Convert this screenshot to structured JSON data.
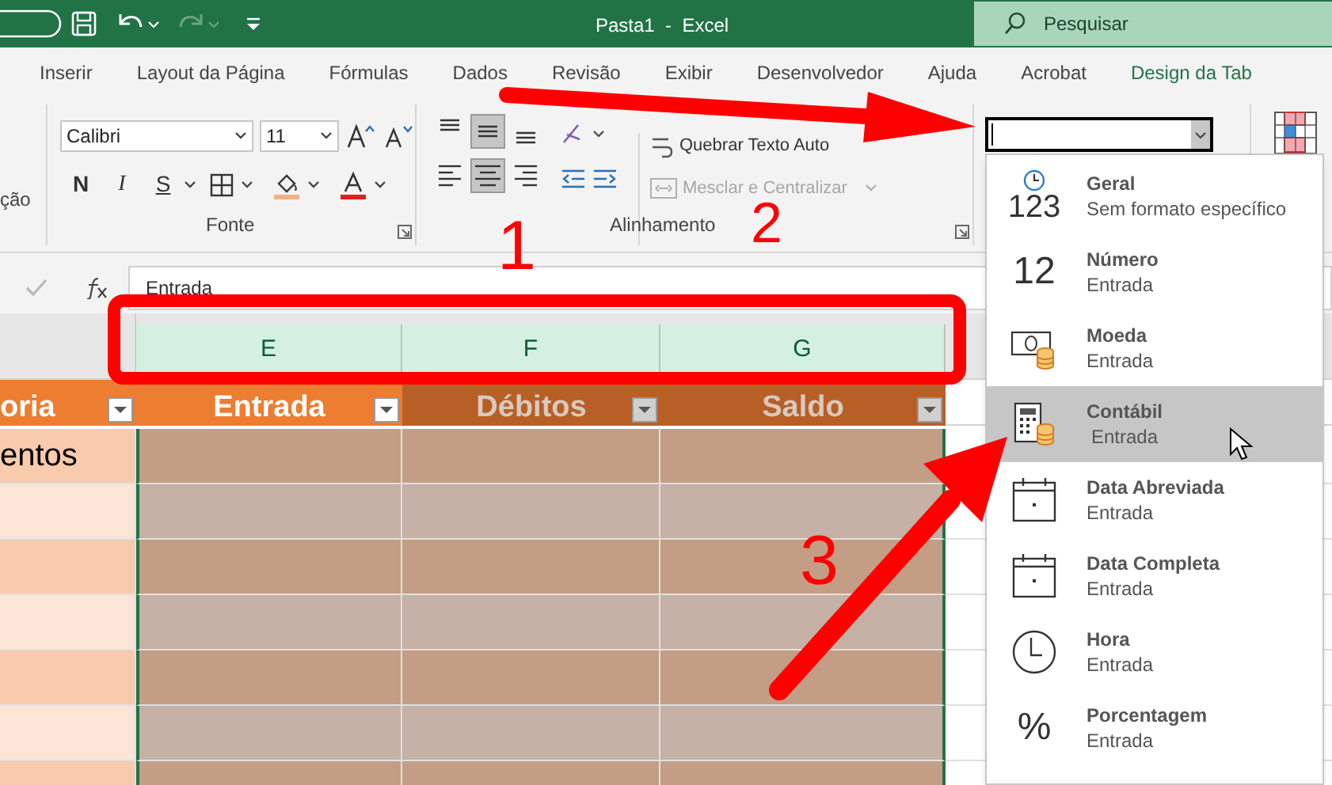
{
  "title_bar": {
    "title": "Pasta1  -  Excel",
    "search": {
      "placeholder": "Pesquisar"
    }
  },
  "ribbon_tabs": [
    {
      "label": "Inserir",
      "kind": "standard",
      "selected": false
    },
    {
      "label": "Layout da Página",
      "kind": "standard",
      "selected": false
    },
    {
      "label": "Fórmulas",
      "kind": "standard",
      "selected": false
    },
    {
      "label": "Dados",
      "kind": "standard",
      "selected": false
    },
    {
      "label": "Revisão",
      "kind": "standard",
      "selected": false
    },
    {
      "label": "Exibir",
      "kind": "standard",
      "selected": false
    },
    {
      "label": "Desenvolvedor",
      "kind": "standard",
      "selected": false
    },
    {
      "label": "Ajuda",
      "kind": "standard",
      "selected": false
    },
    {
      "label": "Acrobat",
      "kind": "standard",
      "selected": false
    },
    {
      "label": "Design da Tab",
      "kind": "contextual",
      "selected": false
    }
  ],
  "ribbon": {
    "cut_group_label": "ção",
    "font": {
      "name": "Calibri",
      "size": "11"
    },
    "style_buttons": [
      {
        "label": "N",
        "kind": "bold"
      },
      {
        "label": "I",
        "kind": "italic"
      },
      {
        "label": "S",
        "kind": "underline"
      }
    ],
    "font_group_label": "Fonte",
    "vertical_align": [
      {
        "selected": false
      },
      {
        "selected": true
      },
      {
        "selected": false
      }
    ],
    "horizontal_align": [
      {
        "selected": false
      },
      {
        "selected": true
      },
      {
        "selected": false
      }
    ],
    "wrap_text": {
      "label": "Quebrar Texto Auto",
      "disabled": false
    },
    "merge": {
      "label": "Mesclar e Centralizar",
      "disabled": true
    },
    "alignment_group_label": "Alinhamento"
  },
  "formula_bar": {
    "value": "Entrada"
  },
  "sheet": {
    "column_headers": [
      {
        "label": "E",
        "selected": true
      },
      {
        "label": "F",
        "selected": true
      },
      {
        "label": "G",
        "selected": true
      }
    ],
    "table_headers": [
      {
        "label": "oria",
        "kind": "plain"
      },
      {
        "label": "Entrada",
        "kind": "plain"
      },
      {
        "label": "Débitos",
        "kind": "shaded"
      },
      {
        "label": "Saldo",
        "kind": "shaded"
      }
    ],
    "rows": [
      {
        "label": "entos"
      }
    ]
  },
  "format_menu": {
    "items": [
      {
        "kind": "clock",
        "icon_text": "123",
        "title": "Geral",
        "subtitle": "Sem formato específico",
        "selected": false
      },
      {
        "kind": "number",
        "icon_text": "12",
        "title": "Número",
        "subtitle": "Entrada",
        "selected": false
      },
      {
        "kind": "currency",
        "title": "Moeda",
        "subtitle": "Entrada",
        "selected": false
      },
      {
        "kind": "accounting",
        "title": "Contábil",
        "subtitle": "Entrada",
        "selected": true
      },
      {
        "kind": "calendar",
        "title": "Data Abreviada",
        "subtitle": "Entrada",
        "selected": false
      },
      {
        "kind": "calendar",
        "title": "Data Completa",
        "subtitle": "Entrada",
        "selected": false
      },
      {
        "kind": "time",
        "title": "Hora",
        "subtitle": "Entrada",
        "selected": false
      },
      {
        "kind": "percent",
        "icon_text": "%",
        "title": "Porcentagem",
        "subtitle": "Entrada",
        "selected": false
      }
    ]
  },
  "annotations": [
    {
      "label": "1"
    },
    {
      "label": "2"
    },
    {
      "label": "3"
    }
  ]
}
